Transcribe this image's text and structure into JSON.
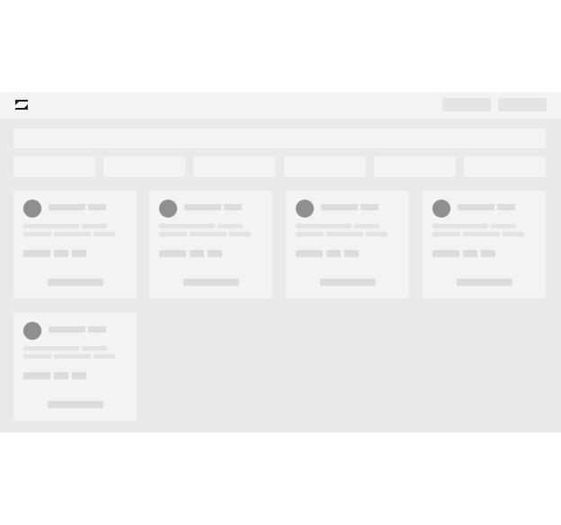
{
  "app": {
    "logo_icon": "zendesk-z-logo-icon",
    "colors": {
      "background": "#e9e9e9",
      "panel": "#f3f3f3",
      "skeleton": "#e3e3e3",
      "avatar": "#8f8f8f",
      "logo": "#1f1f1f"
    }
  },
  "header": {
    "buttons": [
      "placeholder",
      "placeholder"
    ]
  },
  "search": {
    "value": "",
    "placeholder": ""
  },
  "filters": [
    "",
    "",
    "",
    "",
    "",
    ""
  ],
  "cards": [
    {
      "name": "",
      "description": "",
      "tags": "",
      "action": ""
    },
    {
      "name": "",
      "description": "",
      "tags": "",
      "action": ""
    },
    {
      "name": "",
      "description": "",
      "tags": "",
      "action": ""
    },
    {
      "name": "",
      "description": "",
      "tags": "",
      "action": ""
    },
    {
      "name": "",
      "description": "",
      "tags": "",
      "action": ""
    }
  ]
}
